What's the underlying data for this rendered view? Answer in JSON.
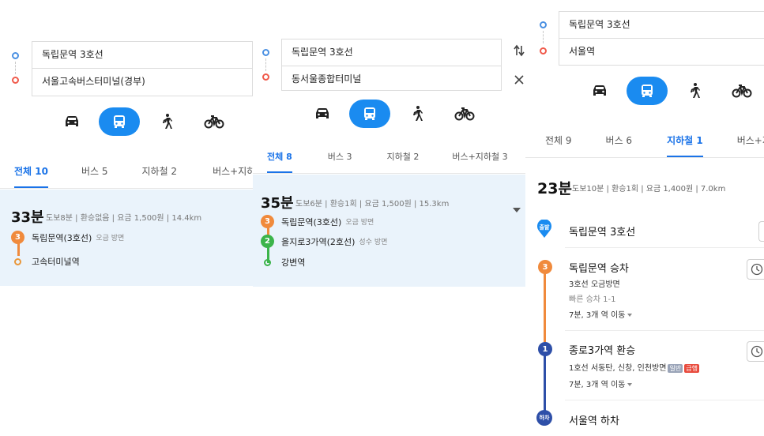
{
  "colors": {
    "accent": "#1a8bf0",
    "line3": "#f08a3c",
    "line2": "#3cb44a",
    "line1": "#2e4fa8",
    "start_marker": "#1a8bf0",
    "result_bg": "#eaf3fb",
    "tag_normal": "#9aa4b8",
    "tag_express": "#e84a3c"
  },
  "panel1": {
    "origin": "독립문역 3호선",
    "destination": "서울고속버스터미널(경부)",
    "modes": [
      {
        "icon": "car-icon",
        "active": false
      },
      {
        "icon": "bus-icon",
        "active": true
      },
      {
        "icon": "walk-icon",
        "active": false
      },
      {
        "icon": "bike-icon",
        "active": false
      }
    ],
    "tabs": [
      "전체 10",
      "버스 5",
      "지하철 2",
      "버스+지하"
    ],
    "result": {
      "time": "33분",
      "meta": "도보8분 | 환승없음 | 요금 1,500원 | 14.4km",
      "step1_badge": "3",
      "step1_name": "독립문역(3호선)",
      "step1_dir": "오금 방면",
      "step2_name": "고속터미널역"
    }
  },
  "panel2": {
    "origin": "독립문역 3호선",
    "destination": "동서울종합터미널",
    "modes": [
      {
        "icon": "car-icon",
        "active": false
      },
      {
        "icon": "bus-icon",
        "active": true
      },
      {
        "icon": "walk-icon",
        "active": false
      },
      {
        "icon": "bike-icon",
        "active": false
      }
    ],
    "tabs": [
      "전체 8",
      "버스 3",
      "지하철 2",
      "버스+지하철 3"
    ],
    "result": {
      "time": "35분",
      "meta": "도보6분 | 환승1회 | 요금 1,500원 | 15.3km",
      "step1_badge": "3",
      "step1_name": "독립문역(3호선)",
      "step1_dir": "오금 방면",
      "step2_badge": "2",
      "step2_name": "을지로3가역(2호선)",
      "step2_dir": "성수 방면",
      "step3_name": "강변역"
    }
  },
  "panel3": {
    "origin": "독립문역 3호선",
    "destination": "서울역",
    "modes": [
      {
        "icon": "car-icon",
        "active": false
      },
      {
        "icon": "bus-icon",
        "active": true
      },
      {
        "icon": "walk-icon",
        "active": false
      },
      {
        "icon": "bike-icon",
        "active": false
      }
    ],
    "tabs": [
      "전체 9",
      "버스 6",
      "지하철 1",
      "버스+지"
    ],
    "summary_time": "23분",
    "summary_meta": "도보10분 | 환승1회 | 요금 1,400원 | 7.0km",
    "start_label": "출발",
    "start_name": "독립문역 3호선",
    "board": {
      "badge": "3",
      "title": "독립문역 승차",
      "line": "3호선 오금방면",
      "fast": "빠른 승차 1-1",
      "move": "7분, 3개 역 이동"
    },
    "transfer": {
      "badge": "1",
      "title": "종로3가역 환승",
      "line": "1호선 서동탄, 신창, 인천방면",
      "tag1": "일반",
      "tag2": "급행",
      "move": "7분, 3개 역 이동"
    },
    "end_label": "하차",
    "end_name": "서울역 하차"
  }
}
